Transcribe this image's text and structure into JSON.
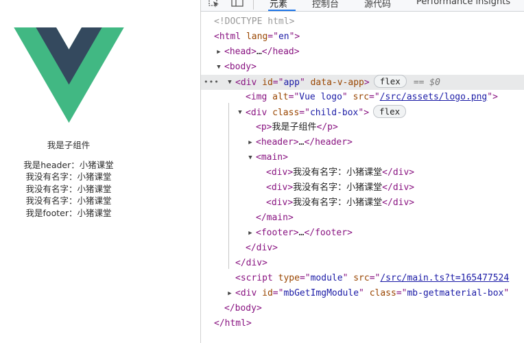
{
  "left_page": {
    "logo": "vue-logo",
    "child_title": "我是子组件",
    "lines": [
      "我是header：小猪课堂",
      "我没有名字：小猪课堂",
      "我没有名字：小猪课堂",
      "我没有名字：小猪课堂",
      "我是footer：小猪课堂"
    ]
  },
  "devtools": {
    "tabs": [
      "元素",
      "控制台",
      "源代码",
      "Performance insights"
    ],
    "active_tab": "元素",
    "badges": {
      "flex": "flex",
      "eq": "== ",
      "var": "$0"
    },
    "lines": {
      "doctype": "<!DOCTYPE html>",
      "html_open_tag": "html",
      "html_lang_attr": "lang",
      "html_lang_val": "en",
      "head_tag": "head",
      "head_collapsed": "…",
      "body_tag": "body",
      "div_tag": "div",
      "id_attr": "id",
      "app_val": "app",
      "data_v_app": "data-v-app",
      "img_tag": "img",
      "alt_attr": "alt",
      "alt_val": "Vue logo",
      "src_attr": "src",
      "logo_src": "/src/assets/logo.png",
      "class_attr": "class",
      "child_box_val": "child-box",
      "p_tag": "p",
      "p_text": "我是子组件",
      "header_tag": "header",
      "main_tag": "main",
      "main_div_text": "我没有名字：小猪课堂",
      "footer_tag": "footer",
      "script_tag": "script",
      "type_attr": "type",
      "module_val": "module",
      "script_src": "/src/main.ts?t=165477524",
      "mb_id_val": "mbGetImgModule",
      "mb_class_val": "mb-getmaterial-box"
    }
  },
  "colors": {
    "tag": "#881280",
    "attr": "#994500",
    "value": "#1a1aa6",
    "vue_green": "#41b883",
    "vue_dark": "#34495e"
  }
}
